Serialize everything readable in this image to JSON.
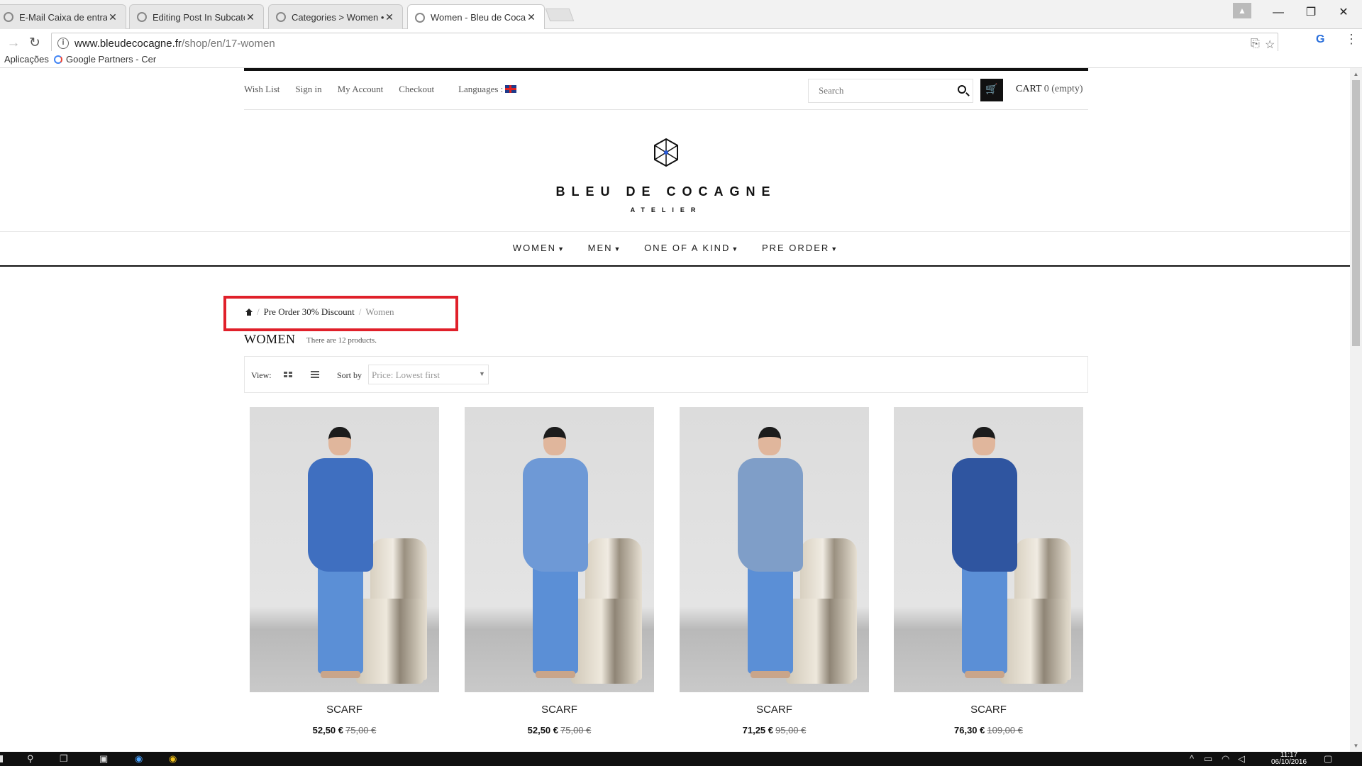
{
  "browser": {
    "tabs": [
      {
        "title": "E-Mail Caixa de entrada",
        "active": false
      },
      {
        "title": "Editing Post In Subcateg",
        "active": false
      },
      {
        "title": "Categories > Women • B",
        "active": false
      },
      {
        "title": "Women - Bleu de Cocag",
        "active": true
      }
    ],
    "url_host": "www.bleudecocagne.fr",
    "url_path": "/shop/en/17-women",
    "bookmarks": [
      "Aplicações",
      "Google Partners - Cer"
    ]
  },
  "header": {
    "links": [
      "Wish List",
      "Sign in",
      "My Account",
      "Checkout"
    ],
    "languages_label": "Languages :",
    "search_placeholder": "Search",
    "cart_label": "CART",
    "cart_status": "0 (empty)"
  },
  "logo": {
    "title": "BLEU DE COCAGNE",
    "subtitle": "ATELIER"
  },
  "main_menu": [
    "WOMEN",
    "MEN",
    "ONE OF A KIND",
    "PRE ORDER"
  ],
  "breadcrumb": {
    "parent": "Pre Order 30% Discount",
    "current": "Women"
  },
  "category": {
    "title": "WOMEN",
    "count_text": "There are 12 products."
  },
  "toolbar": {
    "view_label": "View:",
    "sort_label": "Sort by",
    "sort_value": "Price: Lowest first"
  },
  "products": [
    {
      "name": "SCARF",
      "price": "52,50 €",
      "old_price": "75,00 €",
      "scarf_color": "#3f6fc0"
    },
    {
      "name": "SCARF",
      "price": "52,50 €",
      "old_price": "75,00 €",
      "scarf_color": "#6e99d6"
    },
    {
      "name": "SCARF",
      "price": "71,25 €",
      "old_price": "95,00 €",
      "scarf_color": "#7f9ec8"
    },
    {
      "name": "SCARF",
      "price": "76,30 €",
      "old_price": "109,00 €",
      "scarf_color": "#2f55a0"
    }
  ],
  "taskbar": {
    "time": "11:17",
    "date": "06/10/2016"
  },
  "colors": {
    "highlight": "#e0202a",
    "brand_black": "#111111"
  }
}
